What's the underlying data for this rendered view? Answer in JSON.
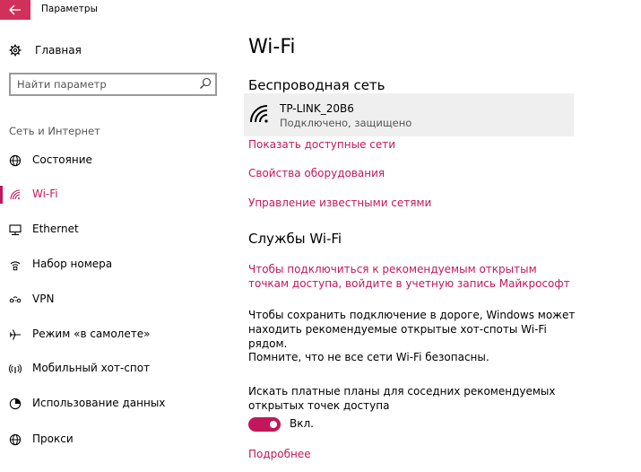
{
  "window": {
    "title": "Параметры"
  },
  "sidebar": {
    "home_label": "Главная",
    "search": {
      "placeholder": "Найти параметр"
    },
    "section_title": "Сеть и Интернет",
    "items": [
      {
        "label": "Состояние",
        "icon": "globe-icon",
        "active": false
      },
      {
        "label": "Wi-Fi",
        "icon": "wifi-icon",
        "active": true
      },
      {
        "label": "Ethernet",
        "icon": "ethernet-icon",
        "active": false
      },
      {
        "label": "Набор номера",
        "icon": "dialup-icon",
        "active": false
      },
      {
        "label": "VPN",
        "icon": "vpn-icon",
        "active": false
      },
      {
        "label": "Режим «в самолете»",
        "icon": "airplane-icon",
        "active": false
      },
      {
        "label": "Мобильный хот-спот",
        "icon": "hotspot-icon",
        "active": false
      },
      {
        "label": "Использование данных",
        "icon": "data-usage-icon",
        "active": false
      },
      {
        "label": "Прокси",
        "icon": "globe-icon",
        "active": false
      }
    ]
  },
  "main": {
    "title": "Wi-Fi",
    "wireless_heading": "Беспроводная сеть",
    "network": {
      "name": "TP-LINK_20B6",
      "status": "Подключено, защищено"
    },
    "links": {
      "show_networks": "Показать доступные сети",
      "hardware_props": "Свойства оборудования",
      "manage_known": "Управление известными сетями"
    },
    "services_heading": "Службы Wi-Fi",
    "signin_link": "Чтобы подключиться к рекомендуемым открытым точкам доступа, войдите в учетную запись Майкрософт",
    "roaming_text": "Чтобы сохранить подключение в дороге, Windows может находить рекомендуемые открытые хот-споты Wi-Fi рядом.",
    "warning_text": "Помните, что не все сети Wi-Fi безопасны.",
    "paid_plans_text": "Искать платные планы для соседних рекомендуемых открытых точек доступа",
    "toggle": {
      "label": "Вкл.",
      "on": true
    },
    "more_link": "Подробнее"
  },
  "colors": {
    "accent": "#c2185b",
    "back_button": "#d0305a",
    "network_bg": "#efefef"
  }
}
